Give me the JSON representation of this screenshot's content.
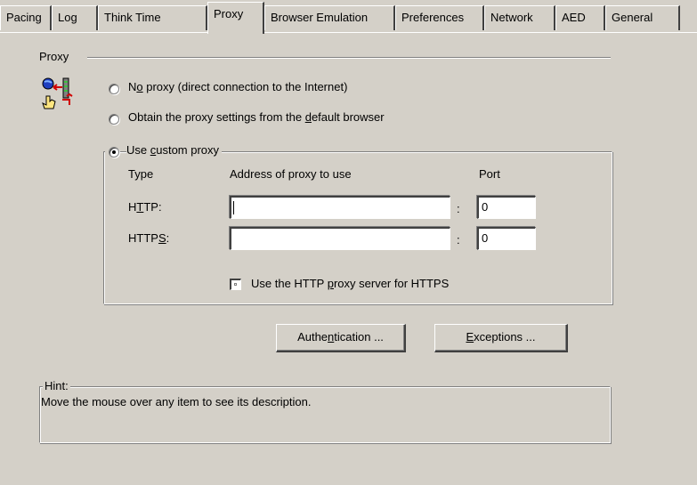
{
  "tabs": [
    {
      "label": "Pacing",
      "active": false
    },
    {
      "label": "Log",
      "active": false
    },
    {
      "label": "Think Time",
      "active": false
    },
    {
      "label": "Proxy",
      "active": true
    },
    {
      "label": "Browser Emulation",
      "active": false
    },
    {
      "label": "Preferences",
      "active": false
    },
    {
      "label": "Network",
      "active": false
    },
    {
      "label": "AED",
      "active": false
    },
    {
      "label": "General",
      "active": false
    }
  ],
  "proxy_group": {
    "title": "Proxy",
    "icon": "proxy-settings-icon",
    "options": {
      "no_proxy": {
        "pre": "N",
        "accel": "o",
        "post": " proxy (direct connection to the Internet)",
        "selected": false
      },
      "default_browser": {
        "pre": "Obtain the proxy settings from the ",
        "accel": "d",
        "post": "efault browser",
        "selected": false
      },
      "custom": {
        "pre": "Use ",
        "accel": "c",
        "post": "ustom proxy",
        "selected": true
      }
    }
  },
  "custom_proxy": {
    "col_type": "Type",
    "col_address": "Address of proxy to use",
    "col_port": "Port",
    "rows": {
      "http": {
        "pre": "H",
        "accel": "T",
        "post": "TP:",
        "address": "",
        "port": "0"
      },
      "https": {
        "pre": "HTTP",
        "accel": "S",
        "post": ":",
        "address": "",
        "port": "0"
      }
    },
    "separator": ":",
    "use_http_for_https": {
      "pre": "Use the HTTP ",
      "accel": "p",
      "post": "roxy server for HTTPS",
      "checked": false
    }
  },
  "buttons": {
    "authentication": {
      "pre": "Authe",
      "accel": "n",
      "post": "tication ..."
    },
    "exceptions": {
      "pre": "",
      "accel": "E",
      "post": "xceptions ..."
    }
  },
  "hint": {
    "title": "Hint:",
    "text": "Move the mouse over any item to see its description."
  },
  "colors": {
    "face": "#d4d0c8",
    "shadow": "#808080",
    "dark": "#404040",
    "highlight": "#ffffff"
  }
}
